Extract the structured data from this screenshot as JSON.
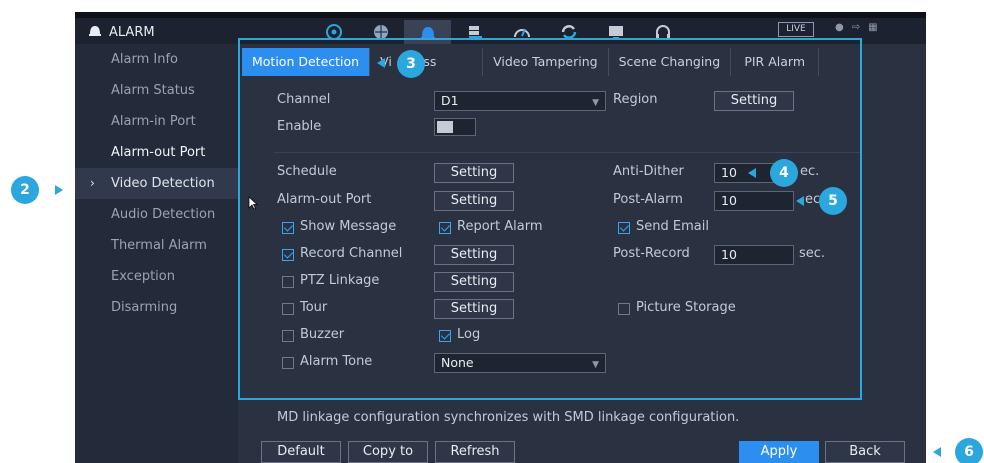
{
  "app": {
    "title": "ALARM",
    "live_label": "LIVE"
  },
  "nav_icons": [
    "camera-icon",
    "network-icon",
    "alarm-icon",
    "storage-icon",
    "performance-icon",
    "sync-icon",
    "display-icon",
    "headset-icon"
  ],
  "sidebar": {
    "items": [
      {
        "label": "Alarm Info"
      },
      {
        "label": "Alarm Status"
      },
      {
        "label": "Alarm-in Port"
      },
      {
        "label": "Alarm-out Port"
      },
      {
        "label": "Video Detection"
      },
      {
        "label": "Audio Detection"
      },
      {
        "label": "Thermal Alarm"
      },
      {
        "label": "Exception"
      },
      {
        "label": "Disarming"
      }
    ],
    "caret": "›"
  },
  "tabs": [
    {
      "label": "Motion Detection"
    },
    {
      "label": "Vi      oss"
    },
    {
      "label": "Video Tampering"
    },
    {
      "label": "Scene Changing"
    },
    {
      "label": "PIR Alarm"
    }
  ],
  "form": {
    "channel_label": "Channel",
    "channel_value": "D1",
    "region_label": "Region",
    "setting_label": "Setting",
    "enable_label": "Enable",
    "schedule_label": "Schedule",
    "anti_dither_label": "Anti-Dither",
    "anti_dither_value": "10",
    "anti_dither_unit": "ec.",
    "alarm_out_label": "Alarm-out Port",
    "post_alarm_label": "Post-Alarm",
    "post_alarm_value": "10",
    "post_alarm_unit": "ec",
    "show_message_label": "Show Message",
    "report_alarm_label": "Report Alarm",
    "send_email_label": "Send Email",
    "record_channel_label": "Record Channel",
    "post_record_label": "Post-Record",
    "post_record_value": "10",
    "post_record_unit": "sec.",
    "ptz_label": "PTZ Linkage",
    "tour_label": "Tour",
    "picture_storage_label": "Picture Storage",
    "buzzer_label": "Buzzer",
    "log_label": "Log",
    "alarm_tone_label": "Alarm Tone",
    "alarm_tone_value": "None"
  },
  "note": "MD linkage configuration synchronizes with SMD linkage configuration.",
  "buttons": {
    "default": "Default",
    "copy_to": "Copy to",
    "refresh": "Refresh",
    "apply": "Apply",
    "back": "Back"
  },
  "callouts": {
    "b2": "2",
    "b3": "3",
    "b4": "4",
    "b5": "5",
    "b6": "6"
  },
  "colors": {
    "accent": "#2c8ff0",
    "callout": "#2ba7de"
  }
}
